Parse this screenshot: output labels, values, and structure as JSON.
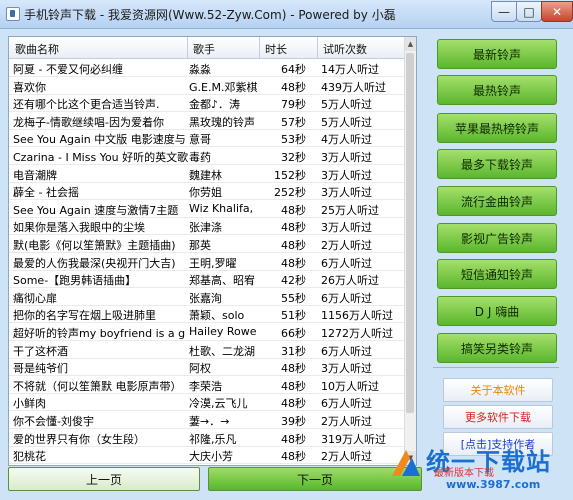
{
  "window": {
    "title": "手机铃声下载 - 我爱资源网(Www.52-Zyw.Com) - Powered by 小磊",
    "min_glyph": "—",
    "max_glyph": "□",
    "close_glyph": "✕"
  },
  "table": {
    "headers": [
      "歌曲名称",
      "歌手",
      "时长",
      "试听次数"
    ],
    "rows": [
      {
        "name": "阿夏 - 不爱又何必纠缠",
        "singer": "淼淼",
        "duration": "64秒",
        "plays": "14万人听过"
      },
      {
        "name": "喜欢你",
        "singer": "G.E.M.邓紫棋",
        "duration": "48秒",
        "plays": "439万人听过"
      },
      {
        "name": "还有哪个比这个更合适当铃声.",
        "singer": "金都♪．涛",
        "duration": "79秒",
        "plays": "5万人听过"
      },
      {
        "name": "龙梅子-情歌继续唱-因为爱着你",
        "singer": "黑玫瑰的铃声",
        "duration": "57秒",
        "plays": "5万人听过"
      },
      {
        "name": "See You Again 中文版 电影速度与",
        "singer": "意哥",
        "duration": "53秒",
        "plays": "4万人听过"
      },
      {
        "name": "Czarina - I Miss You 好听的英文歌",
        "singer": "毒药",
        "duration": "32秒",
        "plays": "3万人听过"
      },
      {
        "name": "电音潮牌",
        "singer": "魏建林",
        "duration": "152秒",
        "plays": "3万人听过"
      },
      {
        "name": "薜全 - 社会摇",
        "singer": "你劳姐",
        "duration": "252秒",
        "plays": "3万人听过"
      },
      {
        "name": "See You Again 速度与激情7主题",
        "singer": "Wiz Khalifa,",
        "duration": "48秒",
        "plays": "25万人听过"
      },
      {
        "name": "如果你是落入我眼中的尘埃",
        "singer": "张津涤",
        "duration": "48秒",
        "plays": "3万人听过"
      },
      {
        "name": "默(电影《何以笙箫默》主题插曲)",
        "singer": "那英",
        "duration": "48秒",
        "plays": "2万人听过"
      },
      {
        "name": "最爱的人伤我最深(央视开门大吉)",
        "singer": "王明,罗曜",
        "duration": "48秒",
        "plays": "6万人听过"
      },
      {
        "name": "Some-【跑男韩语插曲】",
        "singer": "郑基高、昭宥",
        "duration": "42秒",
        "plays": "26万人听过"
      },
      {
        "name": "痛彻心扉",
        "singer": "张嘉洵",
        "duration": "55秒",
        "plays": "6万人听过"
      },
      {
        "name": "把你的名字写在烟上吸进肺里",
        "singer": "萧颖、solo",
        "duration": "51秒",
        "plays": "1156万人听过"
      },
      {
        "name": "超好听的铃声my boyfriend is a g",
        "singer": "Hailey Rowe",
        "duration": "66秒",
        "plays": "1272万人听过"
      },
      {
        "name": "干了这杯酒",
        "singer": "杜歌、二龙湖",
        "duration": "31秒",
        "plays": "6万人听过"
      },
      {
        "name": "哥是纯爷们",
        "singer": "阿权",
        "duration": "48秒",
        "plays": "3万人听过"
      },
      {
        "name": "不将就（何以笙箫默 电影原声带）",
        "singer": "李荣浩",
        "duration": "48秒",
        "plays": "10万人听过"
      },
      {
        "name": "小鲜肉",
        "singer": "冷漠,云飞儿",
        "duration": "48秒",
        "plays": "6万人听过"
      },
      {
        "name": "你不会懂-刘俊宇",
        "singer": "萋→．→",
        "duration": "39秒",
        "plays": "2万人听过"
      },
      {
        "name": "爱的世界只有你（女生段）",
        "singer": "祁隆,乐凡",
        "duration": "48秒",
        "plays": "319万人听过"
      },
      {
        "name": "犯桃花",
        "singer": "大庆小芳",
        "duration": "48秒",
        "plays": "2万人听过"
      }
    ]
  },
  "pager": {
    "prev_label": "上一页",
    "next_label": "下一页"
  },
  "sidebar": {
    "categories": [
      "最新铃声",
      "最热铃声",
      "苹果最热榜铃声",
      "最多下载铃声",
      "流行金曲铃声",
      "影视广告铃声",
      "短信通知铃声",
      "D J 嗨曲",
      "搞笑另类铃声"
    ],
    "about_label": "关于本软件",
    "more_label": "更多软件下载",
    "support_label": "[点击]支持作者",
    "colors": {
      "about": "#e8850c",
      "more": "#d81e1e",
      "support": "#1f3fbf"
    }
  },
  "watermark": {
    "brand": "统一下载站",
    "sub": "最新版本下载",
    "url": "www.3987.com"
  }
}
